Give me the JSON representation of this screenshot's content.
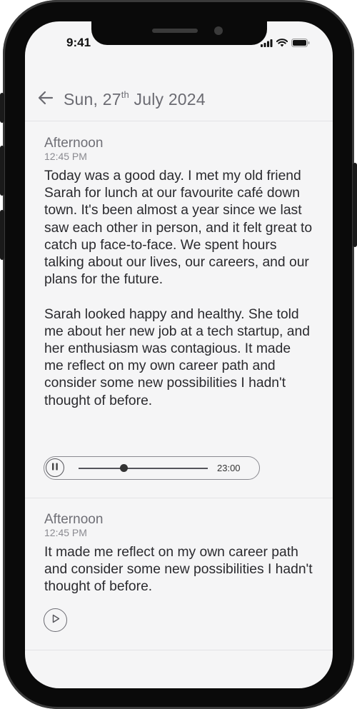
{
  "status_bar": {
    "time": "9:41"
  },
  "header": {
    "back_icon": "arrow-left-icon",
    "date_day": "Sun, 27",
    "date_suffix": "th",
    "date_rest": " July 2024"
  },
  "entries": [
    {
      "period": "Afternoon",
      "time": "12:45 PM",
      "text": "Today was a good day. I met my old friend Sarah for lunch at our favourite café down town. It's been almost a year since we last saw each other in person, and it felt great to catch up face-to-face. We spent hours talking about our lives, our careers, and our plans for the future.\n\nSarah looked happy and healthy. She told me about her new job at a tech startup, and her enthusiasm was contagious. It made me reflect on my own career path and consider some new possibilities I hadn't thought of before.",
      "audio": {
        "state": "playing",
        "progress": 0.35,
        "duration": "23:00",
        "icon": "pause-icon"
      }
    },
    {
      "period": "Afternoon",
      "time": "12:45 PM",
      "text": "It made me reflect on my own career path and consider some new possibilities I hadn't thought of before.",
      "audio": {
        "state": "paused",
        "icon": "play-icon"
      }
    }
  ]
}
